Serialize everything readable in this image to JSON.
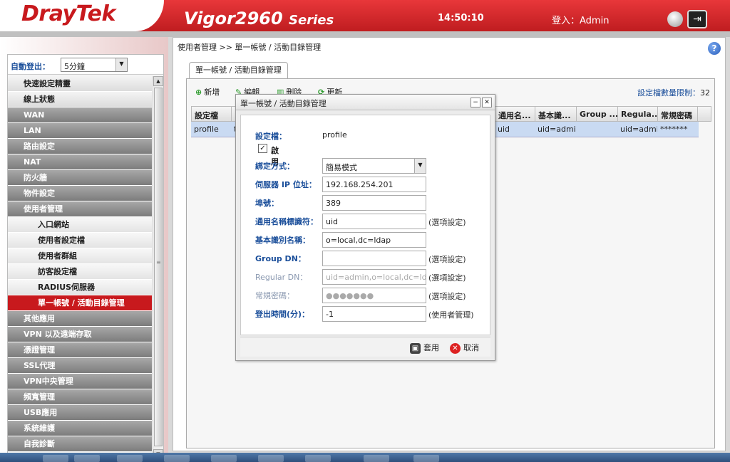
{
  "header": {
    "logo": "DrayTek",
    "product": "Vigor2960",
    "series": "Series",
    "time": "14:50:10",
    "login_label": "登入：",
    "user": "Admin"
  },
  "sidebar": {
    "autologout_label": "自動登出：",
    "autologout_value": "5分鐘",
    "items": [
      {
        "label": "快速設定精靈",
        "kind": "top"
      },
      {
        "label": "線上狀態",
        "kind": "top"
      },
      {
        "label": "WAN",
        "kind": "gray"
      },
      {
        "label": "LAN",
        "kind": "gray"
      },
      {
        "label": "路由設定",
        "kind": "gray"
      },
      {
        "label": "NAT",
        "kind": "gray"
      },
      {
        "label": "防火牆",
        "kind": "gray"
      },
      {
        "label": "物件設定",
        "kind": "gray"
      },
      {
        "label": "使用者管理",
        "kind": "gray"
      },
      {
        "label": "入口網站",
        "kind": "sub"
      },
      {
        "label": "使用者設定檔",
        "kind": "sub"
      },
      {
        "label": "使用者群組",
        "kind": "sub"
      },
      {
        "label": "訪客設定檔",
        "kind": "sub"
      },
      {
        "label": "RADIUS伺服器",
        "kind": "sub"
      },
      {
        "label": "單一帳號 / 活動目錄管理",
        "kind": "active"
      },
      {
        "label": "其他應用",
        "kind": "gray"
      },
      {
        "label": "VPN 以及遠端存取",
        "kind": "gray"
      },
      {
        "label": "憑證管理",
        "kind": "gray"
      },
      {
        "label": "SSL代理",
        "kind": "gray"
      },
      {
        "label": "VPN中央管理",
        "kind": "gray"
      },
      {
        "label": "頻寬管理",
        "kind": "gray"
      },
      {
        "label": "USB應用",
        "kind": "gray"
      },
      {
        "label": "系統維護",
        "kind": "gray"
      },
      {
        "label": "自我診斷",
        "kind": "gray"
      }
    ]
  },
  "main": {
    "breadcrumb": "使用者管理 >> 單一帳號 / 活動目錄管理",
    "tab": "單一帳號 / 活動目錄管理",
    "toolbar": {
      "add": "新增",
      "edit": "編輯",
      "delete": "刪除",
      "refresh": "更新",
      "limit_label": "設定檔數量限制：",
      "limit_value": "32"
    },
    "columns": [
      "設定檔",
      "",
      "通用名...",
      "基本識...",
      "Group ...",
      "Regula...",
      "常規密碼"
    ],
    "row": [
      "profile",
      "t",
      "uid",
      "uid=admi...",
      "",
      "uid=admi...",
      "*******"
    ]
  },
  "dialog": {
    "title": "單一帳號 / 活動目錄管理",
    "profile_label": "設定檔：",
    "profile_value": "profile",
    "enable_label": "啟用",
    "bind_label": "綁定方式：",
    "bind_value": "簡易模式",
    "server_label": "伺服器 IP 位址：",
    "server_value": "192.168.254.201",
    "port_label": "埠號：",
    "port_value": "389",
    "cn_label": "通用名稱標識符：",
    "cn_value": "uid",
    "cn_note": "(選項設定)",
    "basedn_label": "基本識別名稱：",
    "basedn_value": "o=local,dc=ldap",
    "groupdn_label": "Group DN：",
    "groupdn_value": "",
    "groupdn_note": "(選項設定)",
    "regdn_label": "Regular DN：",
    "regdn_value": "uid=admin,o=local,dc=ldap",
    "regdn_note": "(選項設定)",
    "regpw_label": "常規密碼：",
    "regpw_value": "●●●●●●●",
    "regpw_note": "(選項設定)",
    "timeout_label": "登出時間(分)：",
    "timeout_value": "-1",
    "timeout_note": "(使用者管理)",
    "apply": "套用",
    "cancel": "取消"
  }
}
